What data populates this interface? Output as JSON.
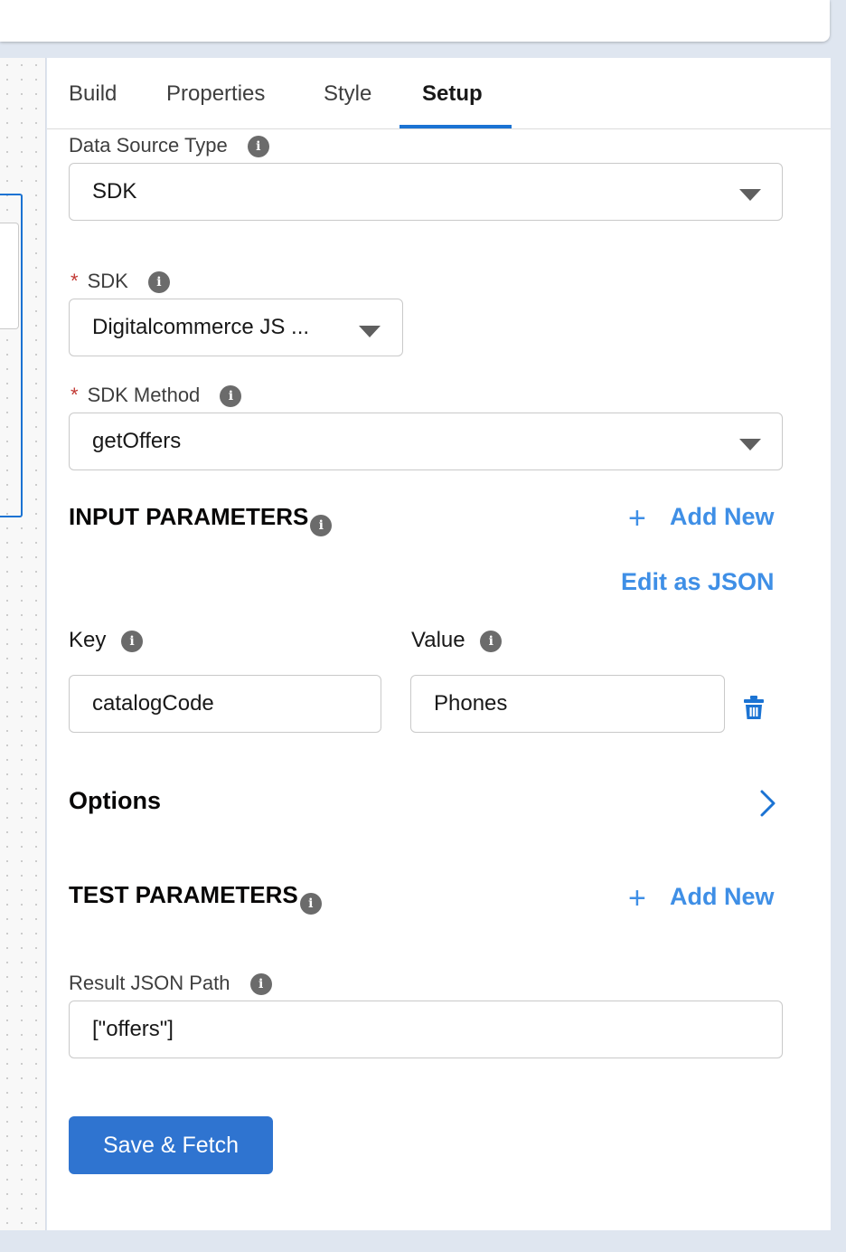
{
  "tabs": [
    {
      "label": "Build"
    },
    {
      "label": "Properties"
    },
    {
      "label": "Style"
    },
    {
      "label": "Setup"
    }
  ],
  "active_tab": "Setup",
  "data_source_type": {
    "label": "Data Source Type",
    "value": "SDK"
  },
  "sdk": {
    "required_mark": "*",
    "label": "SDK",
    "value": "Digitalcommerce JS ..."
  },
  "sdk_method": {
    "required_mark": "*",
    "label": "SDK Method",
    "value": "getOffers"
  },
  "input_parameters": {
    "title": "INPUT PARAMETERS",
    "add_new_label": "Add New",
    "add_new_icon": "plus-icon",
    "edit_json_label": "Edit as JSON",
    "key_label": "Key",
    "value_label": "Value",
    "rows": [
      {
        "key": "catalogCode",
        "value": "Phones",
        "delete_icon": "trash-icon"
      }
    ]
  },
  "options": {
    "title": "Options",
    "icon": "chevron-right-icon"
  },
  "test_parameters": {
    "title": "TEST PARAMETERS",
    "add_new_label": "Add New",
    "add_new_icon": "plus-icon"
  },
  "result_json_path": {
    "label": "Result JSON Path",
    "value": "[\"offers\"]"
  },
  "save_fetch_label": "Save & Fetch",
  "info_icon": "i",
  "colors": {
    "accent": "#1b73d3",
    "link": "#3f8fe6",
    "button": "#2f74d0",
    "required": "#c23934"
  }
}
